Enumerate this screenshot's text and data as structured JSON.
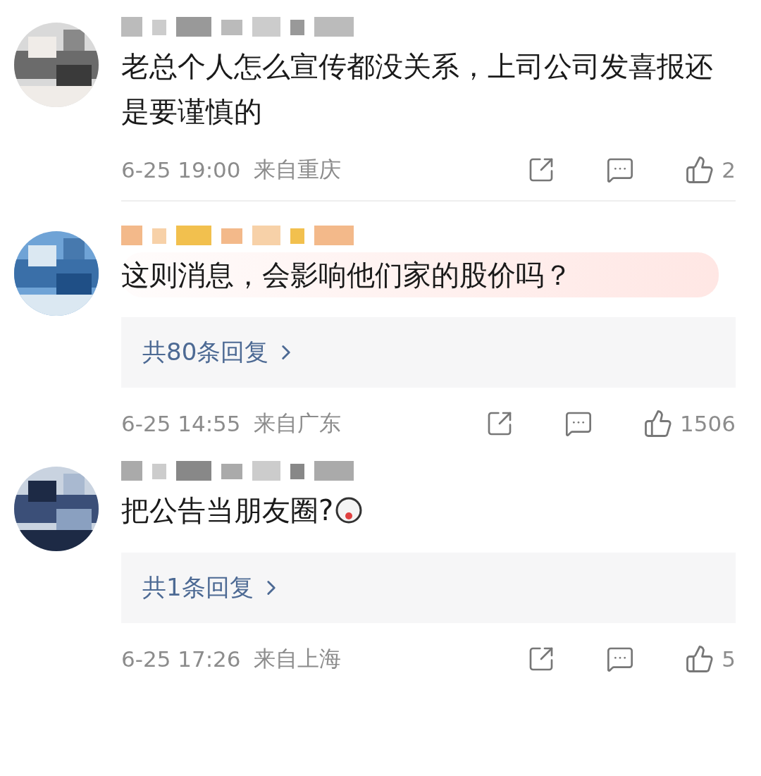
{
  "comments": [
    {
      "text": "老总个人怎么宣传都没关系，上司公司发喜报还是要谨慎的",
      "highlighted": false,
      "emoji": false,
      "time": "6-25 19:00",
      "location": "来自重庆",
      "likes": "2",
      "divider": true
    },
    {
      "text": "这则消息，会影响他们家的股价吗？",
      "highlighted": true,
      "emoji": false,
      "replies": "共80条回复",
      "time": "6-25 14:55",
      "location": "来自广东",
      "likes": "1506",
      "divider": false
    },
    {
      "text": "把公告当朋友圈?",
      "highlighted": false,
      "emoji": true,
      "replies": "共1条回复",
      "time": "6-25 17:26",
      "location": "来自上海",
      "likes": "5",
      "divider": false
    }
  ]
}
